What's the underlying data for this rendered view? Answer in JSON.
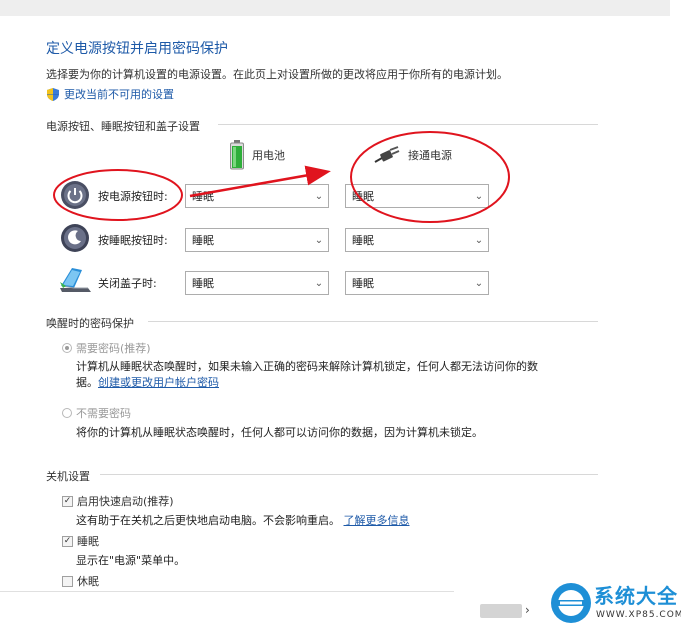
{
  "header": {
    "title": "定义电源按钮并启用密码保护",
    "description": "选择要为你的计算机设置的电源设置。在此页上对设置所做的更改将应用于你所有的电源计划。",
    "change_link": "更改当前不可用的设置"
  },
  "buttons_section": {
    "title": "电源按钮、睡眠按钮和盖子设置",
    "battery_label": "用电池",
    "plugged_label": "接通电源",
    "rows": [
      {
        "label": "按电源按钮时:",
        "battery": "睡眠",
        "plugged": "睡眠"
      },
      {
        "label": "按睡眠按钮时:",
        "battery": "睡眠",
        "plugged": "睡眠"
      },
      {
        "label": "关闭盖子时:",
        "battery": "睡眠",
        "plugged": "睡眠"
      }
    ]
  },
  "password_section": {
    "title": "唤醒时的密码保护",
    "require_label": "需要密码(推荐)",
    "require_desc_1": "计算机从睡眠状态唤醒时，如果未输入正确的密码来解除计算机锁定，任何人都无法访问你的数",
    "require_desc_2_prefix": "据。",
    "require_link": "创建或更改用户帐户密码",
    "no_require_label": "不需要密码",
    "no_require_desc": "将你的计算机从睡眠状态唤醒时，任何人都可以访问你的数据，因为计算机未锁定。"
  },
  "shutdown_section": {
    "title": "关机设置",
    "fast_startup_label": "启用快速启动(推荐)",
    "fast_startup_desc": "这有助于在关机之后更快地启动电脑。不会影响重启。",
    "learn_more": "了解更多信息",
    "sleep_label": "睡眠",
    "sleep_desc": "显示在\"电源\"菜单中。",
    "hibernate_label": "休眠"
  },
  "footer": {
    "chevron": "›",
    "logo_text": "系统大全",
    "logo_url": "WWW.XP85.COM"
  },
  "colors": {
    "link": "#1e5aa8",
    "annotation_red": "#e0141e",
    "logo_blue": "#1e8fd6"
  }
}
